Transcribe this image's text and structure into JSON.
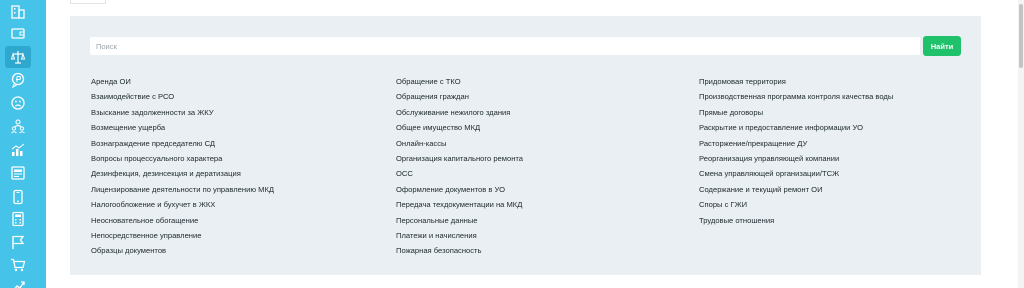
{
  "sidebar": {
    "icons": [
      "building-icon",
      "wallet-icon",
      "scales-icon",
      "ruble-chat-icon",
      "sad-face-icon",
      "people-group-icon",
      "chart-icon",
      "contract-icon",
      "phone-icon",
      "calculator-icon",
      "flag-icon",
      "cart-icon",
      "growth-icon"
    ],
    "active_index": 2,
    "colors": {
      "background": "#45c3e8",
      "active": "#2fa8cf"
    }
  },
  "search": {
    "placeholder": "Поиск",
    "value": "",
    "button_label": "Найти",
    "button_color": "#1fc16b"
  },
  "topics": {
    "column1": [
      "Аренда ОИ",
      "Взаимодействие с РСО",
      "Взыскание задолженности за ЖКУ",
      "Возмещение ущерба",
      "Вознаграждение председателю СД",
      "Вопросы процессуального характера",
      "Дезинфекция, дезинсекция и дератизация",
      "Лицензирование деятельности по управлению МКД",
      "Налогообложение и бухучет в ЖКХ",
      "Неосновательное обогащение",
      "Непосредственное управление",
      "Образцы документов"
    ],
    "column2": [
      "Обращение с ТКО",
      "Обращения граждан",
      "Обслуживание нежилого здания",
      "Общее имущество МКД",
      "Онлайн-кассы",
      "Организация капитального ремонта",
      "ОСС",
      "Оформление документов в УО",
      "Передача техдокументации на МКД",
      "Персональные данные",
      "Платежи и начисления",
      "Пожарная безопасность"
    ],
    "column3": [
      "Придомовая территория",
      "Производственная программа контроля качества воды",
      "Прямые договоры",
      "Раскрытие и предоставление информации УО",
      "Расторжение/прекращение ДУ",
      "Реорганизация управляющей компании",
      "Смена управляющей организации/ТСЖ",
      "Содержание и текущий ремонт ОИ",
      "Споры с ГЖИ",
      "Трудовые отношения"
    ]
  }
}
